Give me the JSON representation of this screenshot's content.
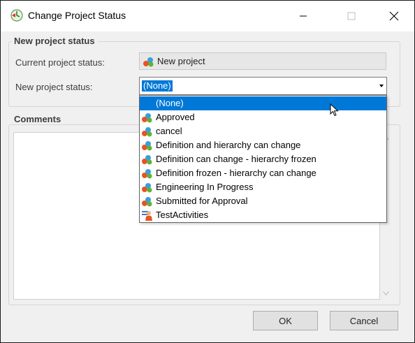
{
  "window": {
    "title": "Change Project Status",
    "controls": [
      "minimize",
      "maximize",
      "close"
    ]
  },
  "status_group": {
    "title": "New project status",
    "current_label": "Current project status:",
    "current_value": "New project",
    "current_icon": "status-icon",
    "new_label": "New project status:",
    "new_value": "(None)"
  },
  "comments_group": {
    "title": "Comments",
    "value": ""
  },
  "dropdown": {
    "items": [
      {
        "label": "(None)",
        "icon": "none",
        "selected": true
      },
      {
        "label": "Approved",
        "icon": "status-icon",
        "selected": false
      },
      {
        "label": "cancel",
        "icon": "status-icon",
        "selected": false
      },
      {
        "label": "Definition and hierarchy can change",
        "icon": "status-icon",
        "selected": false
      },
      {
        "label": "Definition can change - hierarchy frozen",
        "icon": "status-icon",
        "selected": false
      },
      {
        "label": "Definition frozen - hierarchy can change",
        "icon": "status-icon",
        "selected": false
      },
      {
        "label": "Engineering In Progress",
        "icon": "status-icon",
        "selected": false
      },
      {
        "label": "Submitted for Approval",
        "icon": "status-icon",
        "selected": false
      },
      {
        "label": "TestActivities",
        "icon": "activity-person-icon",
        "selected": false
      }
    ]
  },
  "buttons": {
    "ok": "OK",
    "cancel": "Cancel"
  },
  "colors": {
    "accent": "#0078d7",
    "dialog_bg": "#f0f0f0"
  }
}
